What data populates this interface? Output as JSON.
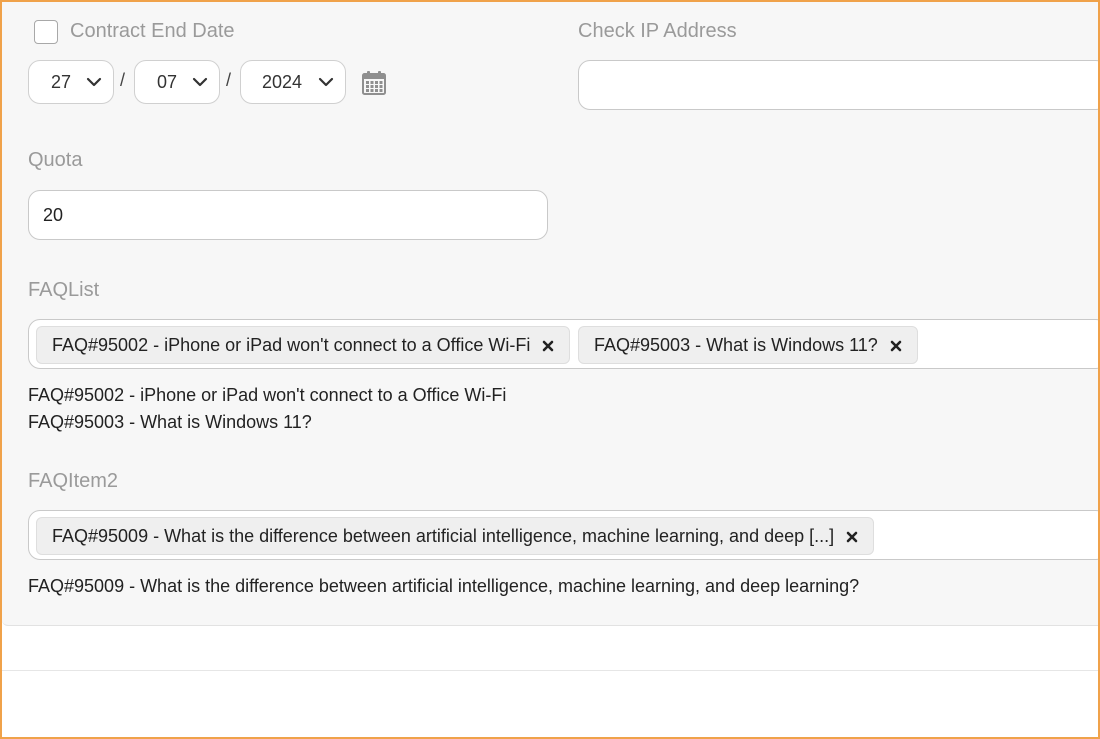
{
  "contract_end": {
    "label": "Contract End Date",
    "checked": false,
    "day": "27",
    "month": "07",
    "year": "2024",
    "separator": "/",
    "icon": "calendar-icon"
  },
  "check_ip": {
    "label": "Check IP Address",
    "value": ""
  },
  "quota": {
    "label": "Quota",
    "value": "20"
  },
  "faq_list": {
    "label": "FAQList",
    "tags": [
      {
        "text": "FAQ#95002 - iPhone or iPad won't connect to a Office Wi-Fi"
      },
      {
        "text": "FAQ#95003 - What is Windows 11?"
      }
    ],
    "lines": [
      "FAQ#95002 - iPhone or iPad won't connect to a Office Wi-Fi",
      "FAQ#95003 - What is Windows 11?"
    ]
  },
  "faq_item2": {
    "label": "FAQItem2",
    "tags": [
      {
        "text": "FAQ#95009 - What is the difference between artificial intelligence, machine learning, and deep [...]"
      }
    ],
    "lines": [
      "FAQ#95009 - What is the difference between artificial intelligence, machine learning, and deep learning?"
    ]
  },
  "colors": {
    "frame_accent": "#f0a24a",
    "panel_bg": "#f7f7f7",
    "label_gray": "#9a9a9a"
  }
}
